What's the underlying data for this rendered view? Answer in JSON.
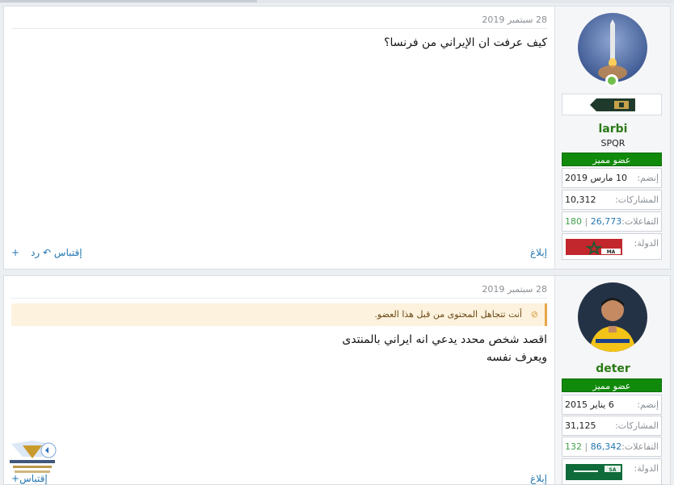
{
  "posts": [
    {
      "date": "28 سبتمبر 2019",
      "content_lines": [
        "كيف عرفت ان الإيراني من فرنسا؟"
      ],
      "actions": {
        "report": "إبلاغ",
        "quote": "إقتباس",
        "reply": "رد"
      },
      "user": {
        "name": "larbi",
        "title": "SPQR",
        "rank": "عضو مميز",
        "joined_label": "إنضم:",
        "joined": "10 مارس 2019",
        "posts_label": "المشاركات:",
        "posts": "10,312",
        "reactions_label": "التفاعلات:",
        "reactions": "26,773",
        "points": "180",
        "country_label": "الدولة:",
        "flag_code": "MA",
        "avatar_icon": "rocket-launch-avatar",
        "online": true
      }
    },
    {
      "date": "28 سبتمبر 2019",
      "ignored_notice": "أنت تتجاهل المحتوى من قبل هذا العضو.",
      "content_lines": [
        "اقصد شخص محدد يدعي انه ايراني بالمنتدى",
        "ويعرف نفسه"
      ],
      "actions": {
        "report": "إبلاغ",
        "quote": "إقتباس"
      },
      "user": {
        "name": "deter",
        "rank": "عضو مميز",
        "joined_label": "إنضم:",
        "joined": "6 يناير 2015",
        "posts_label": "المشاركات:",
        "posts": "31,125",
        "reactions_label": "التفاعلات:",
        "reactions": "86,342",
        "points": "132",
        "country_label": "الدولة:",
        "flag_code": "SA",
        "avatar_icon": "football-player-avatar"
      }
    }
  ],
  "colors": {
    "username": "#2b7a16",
    "rank_bg": "#118a0c",
    "link": "#2577b1",
    "ignored_bg": "#fdf2dd"
  }
}
